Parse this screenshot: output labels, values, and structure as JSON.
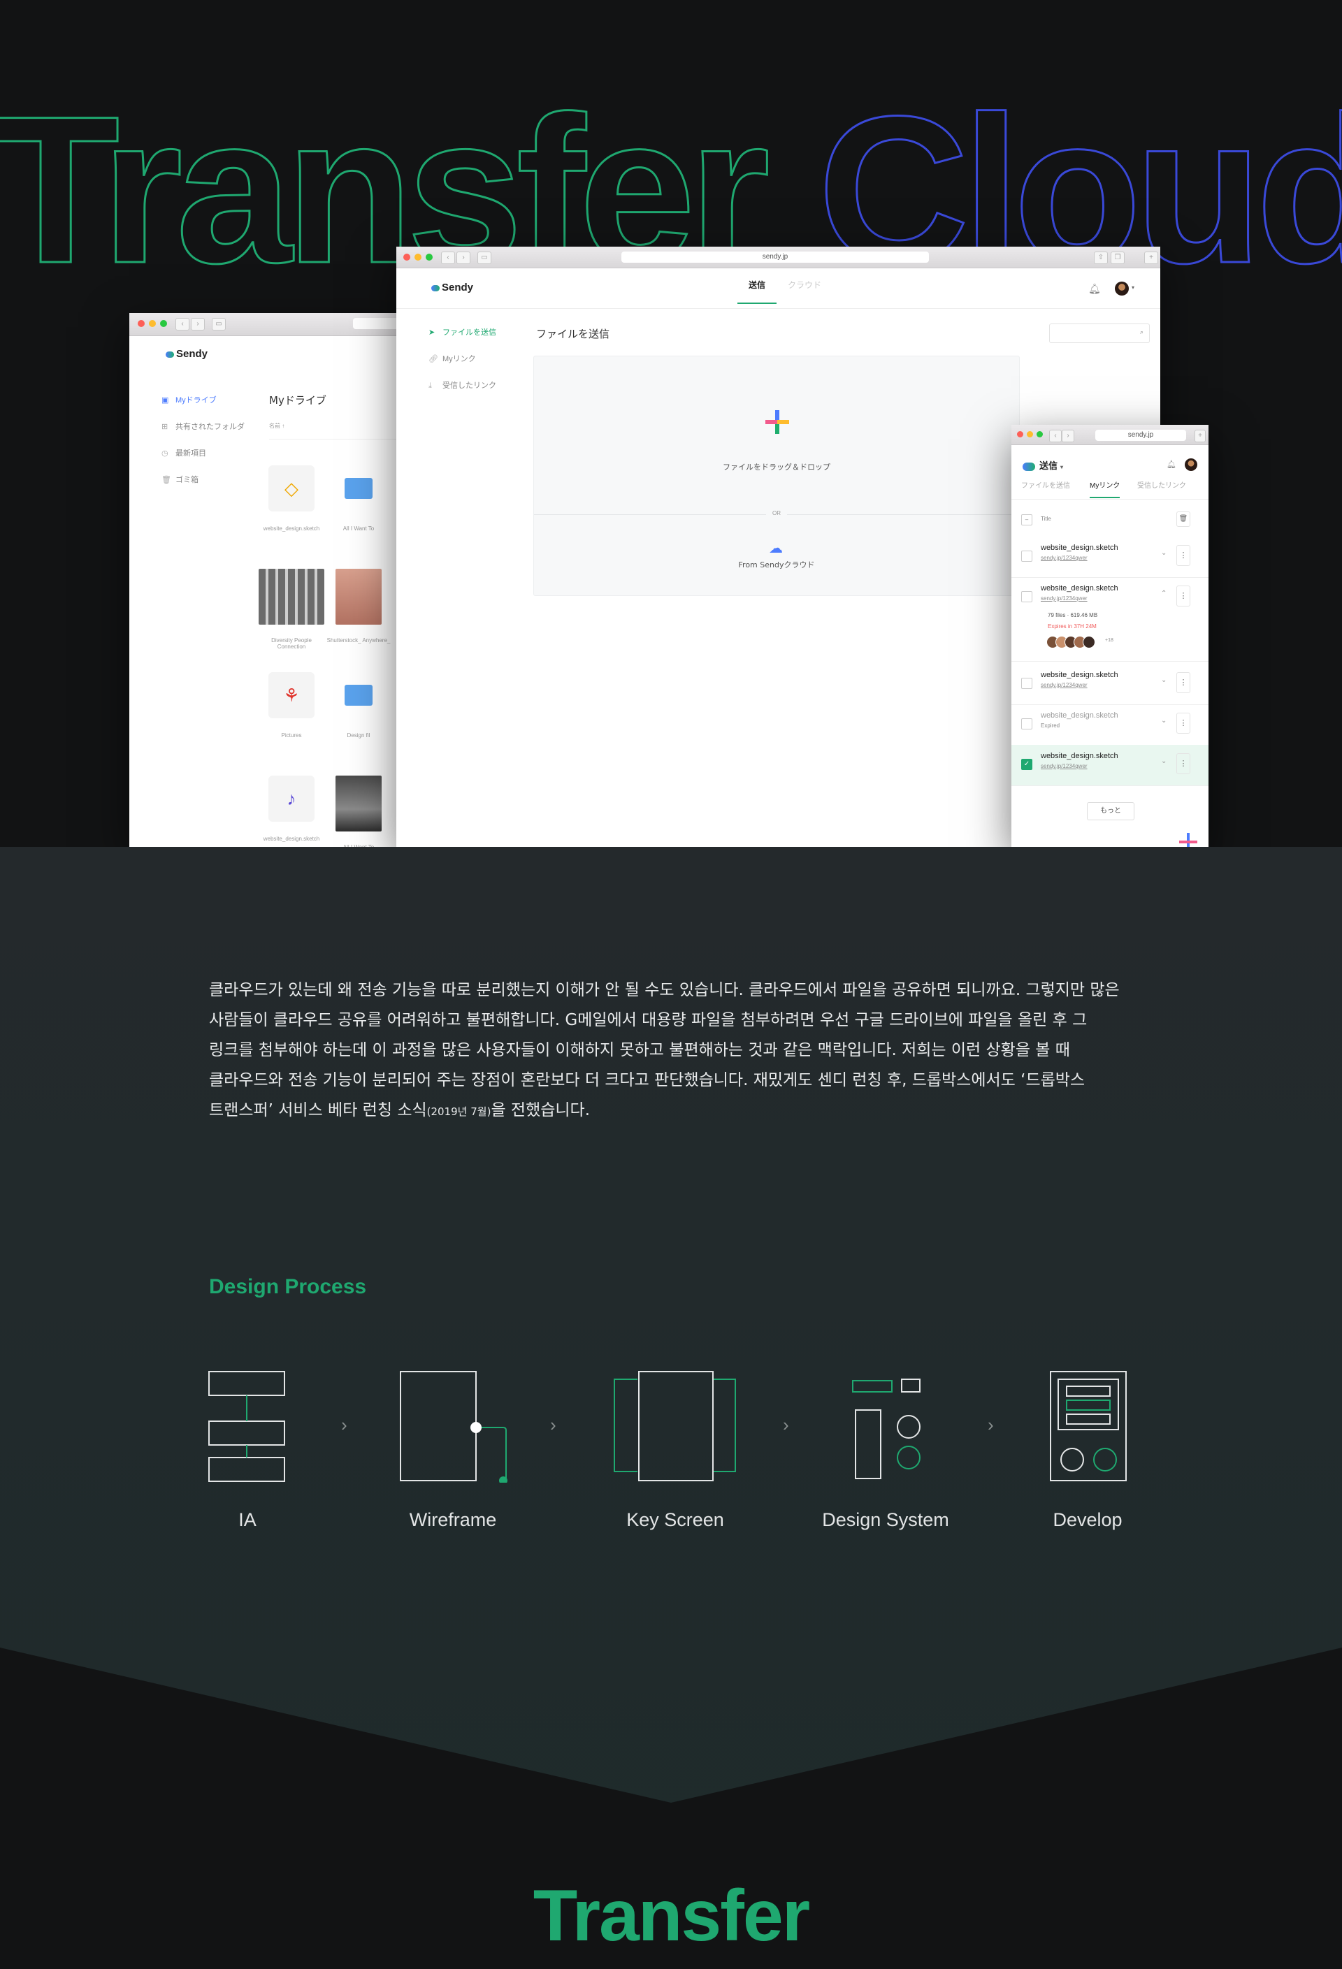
{
  "hero": {
    "title_part1": "Transfer",
    "title_part2": "Cloud",
    "colors": {
      "green": "#1fa870",
      "blue": "#3a49d8"
    }
  },
  "drive_window": {
    "brand": "Sendy",
    "title": "Myドライブ",
    "sort_label": "名前 ↑",
    "sidebar": [
      {
        "label": "Myドライブ",
        "icon": "drive-icon",
        "active": true
      },
      {
        "label": "共有されたフォルダ",
        "icon": "shared-folder-icon"
      },
      {
        "label": "最新項目",
        "icon": "clock-icon"
      },
      {
        "label": "ゴミ箱",
        "icon": "trash-icon"
      }
    ],
    "files": [
      {
        "caption": "website_design.sketch",
        "icon": "sketch-icon"
      },
      {
        "caption": "All I Want To",
        "icon": "folder-icon"
      },
      {
        "caption": "Diversity People Connection",
        "icon": "image-thumb"
      },
      {
        "caption": "Shutterstock_ Anywhere_",
        "icon": "image-thumb"
      },
      {
        "caption": "Pictures",
        "icon": "pdf-icon"
      },
      {
        "caption": "Design fil",
        "icon": "folder-icon"
      },
      {
        "caption": "website_design.sketch",
        "icon": "music-icon"
      },
      {
        "caption": "All I Want To",
        "icon": "image-thumb"
      }
    ]
  },
  "send_window": {
    "url": "sendy.jp",
    "brand": "Sendy",
    "tabs": [
      {
        "label": "送信",
        "active": true
      },
      {
        "label": "クラウド",
        "active": false
      }
    ],
    "sidebar": [
      {
        "label": "ファイルを送信",
        "icon": "send-icon",
        "active": true
      },
      {
        "label": "Myリンク",
        "icon": "link-icon"
      },
      {
        "label": "受信したリンク",
        "icon": "download-icon"
      }
    ],
    "page_title": "ファイルを送信",
    "dropzone_label": "ファイルをドラッグ＆ドロップ",
    "or_label": "OR",
    "cloud_label": "From Sendyクラウド"
  },
  "links_window": {
    "url": "sendy.jp",
    "header_title": "送信",
    "tabs": [
      {
        "label": "ファイルを送信",
        "active": false
      },
      {
        "label": "Myリンク",
        "active": true
      },
      {
        "label": "受信したリンク",
        "active": false
      }
    ],
    "col_title": "Title",
    "rows": [
      {
        "name": "website_design.sketch",
        "link": "sendy.jp/1234qwer",
        "checked": false,
        "expanded": false,
        "muted": false
      },
      {
        "name": "website_design.sketch",
        "link": "sendy.jp/1234qwer",
        "checked": false,
        "expanded": true,
        "muted": false
      },
      {
        "name": "website_design.sketch",
        "link": "sendy.jp/1234qwer",
        "checked": false,
        "expanded": false,
        "muted": false
      },
      {
        "name": "website_design.sketch",
        "link": "Expired",
        "checked": false,
        "expanded": false,
        "muted": true
      },
      {
        "name": "website_design.sketch",
        "link": "sendy.jp/1234qwer",
        "checked": true,
        "expanded": false,
        "muted": false
      }
    ],
    "expanded_info": "79 files · 619.46 MB",
    "expanded_expires": "Expires in 37H 24M",
    "expanded_count": "+18",
    "more_label": "もっと"
  },
  "description": {
    "lines": [
      "클라우드가 있는데 왜 전송 기능을 따로 분리했는지 이해가 안 될 수도 있습니다. 클라우드에서 파일을 공유하면 되니까요. 그렇지만 많은",
      "사람들이 클라우드 공유를 어려워하고 불편해합니다. G메일에서 대용량 파일을 첨부하려면 우선 구글 드라이브에 파일을 올린 후 그",
      "링크를 첨부해야 하는데 이 과정을 많은 사용자들이 이해하지 못하고 불편해하는 것과 같은 맥락입니다. 저희는 이런 상황을 볼 때",
      "클라우드와 전송 기능이 분리되어 주는 장점이 혼란보다 더 크다고 판단했습니다. 재밌게도 센디 런칭 후, 드롭박스에서도 ‘드롭박스",
      "트랜스퍼’ 서비스 베타 런칭 소식",
      "(2019년 7월)",
      "을 전했습니다."
    ]
  },
  "design_process": {
    "title": "Design Process",
    "steps": [
      {
        "label": "IA",
        "icon": "ia-icon"
      },
      {
        "label": "Wireframe",
        "icon": "wireframe-icon"
      },
      {
        "label": "Key Screen",
        "icon": "key-screen-icon"
      },
      {
        "label": "Design System",
        "icon": "design-system-icon"
      },
      {
        "label": "Develop",
        "icon": "develop-icon"
      }
    ],
    "arrow_glyph": "›"
  },
  "bottom_title": "Transfer"
}
